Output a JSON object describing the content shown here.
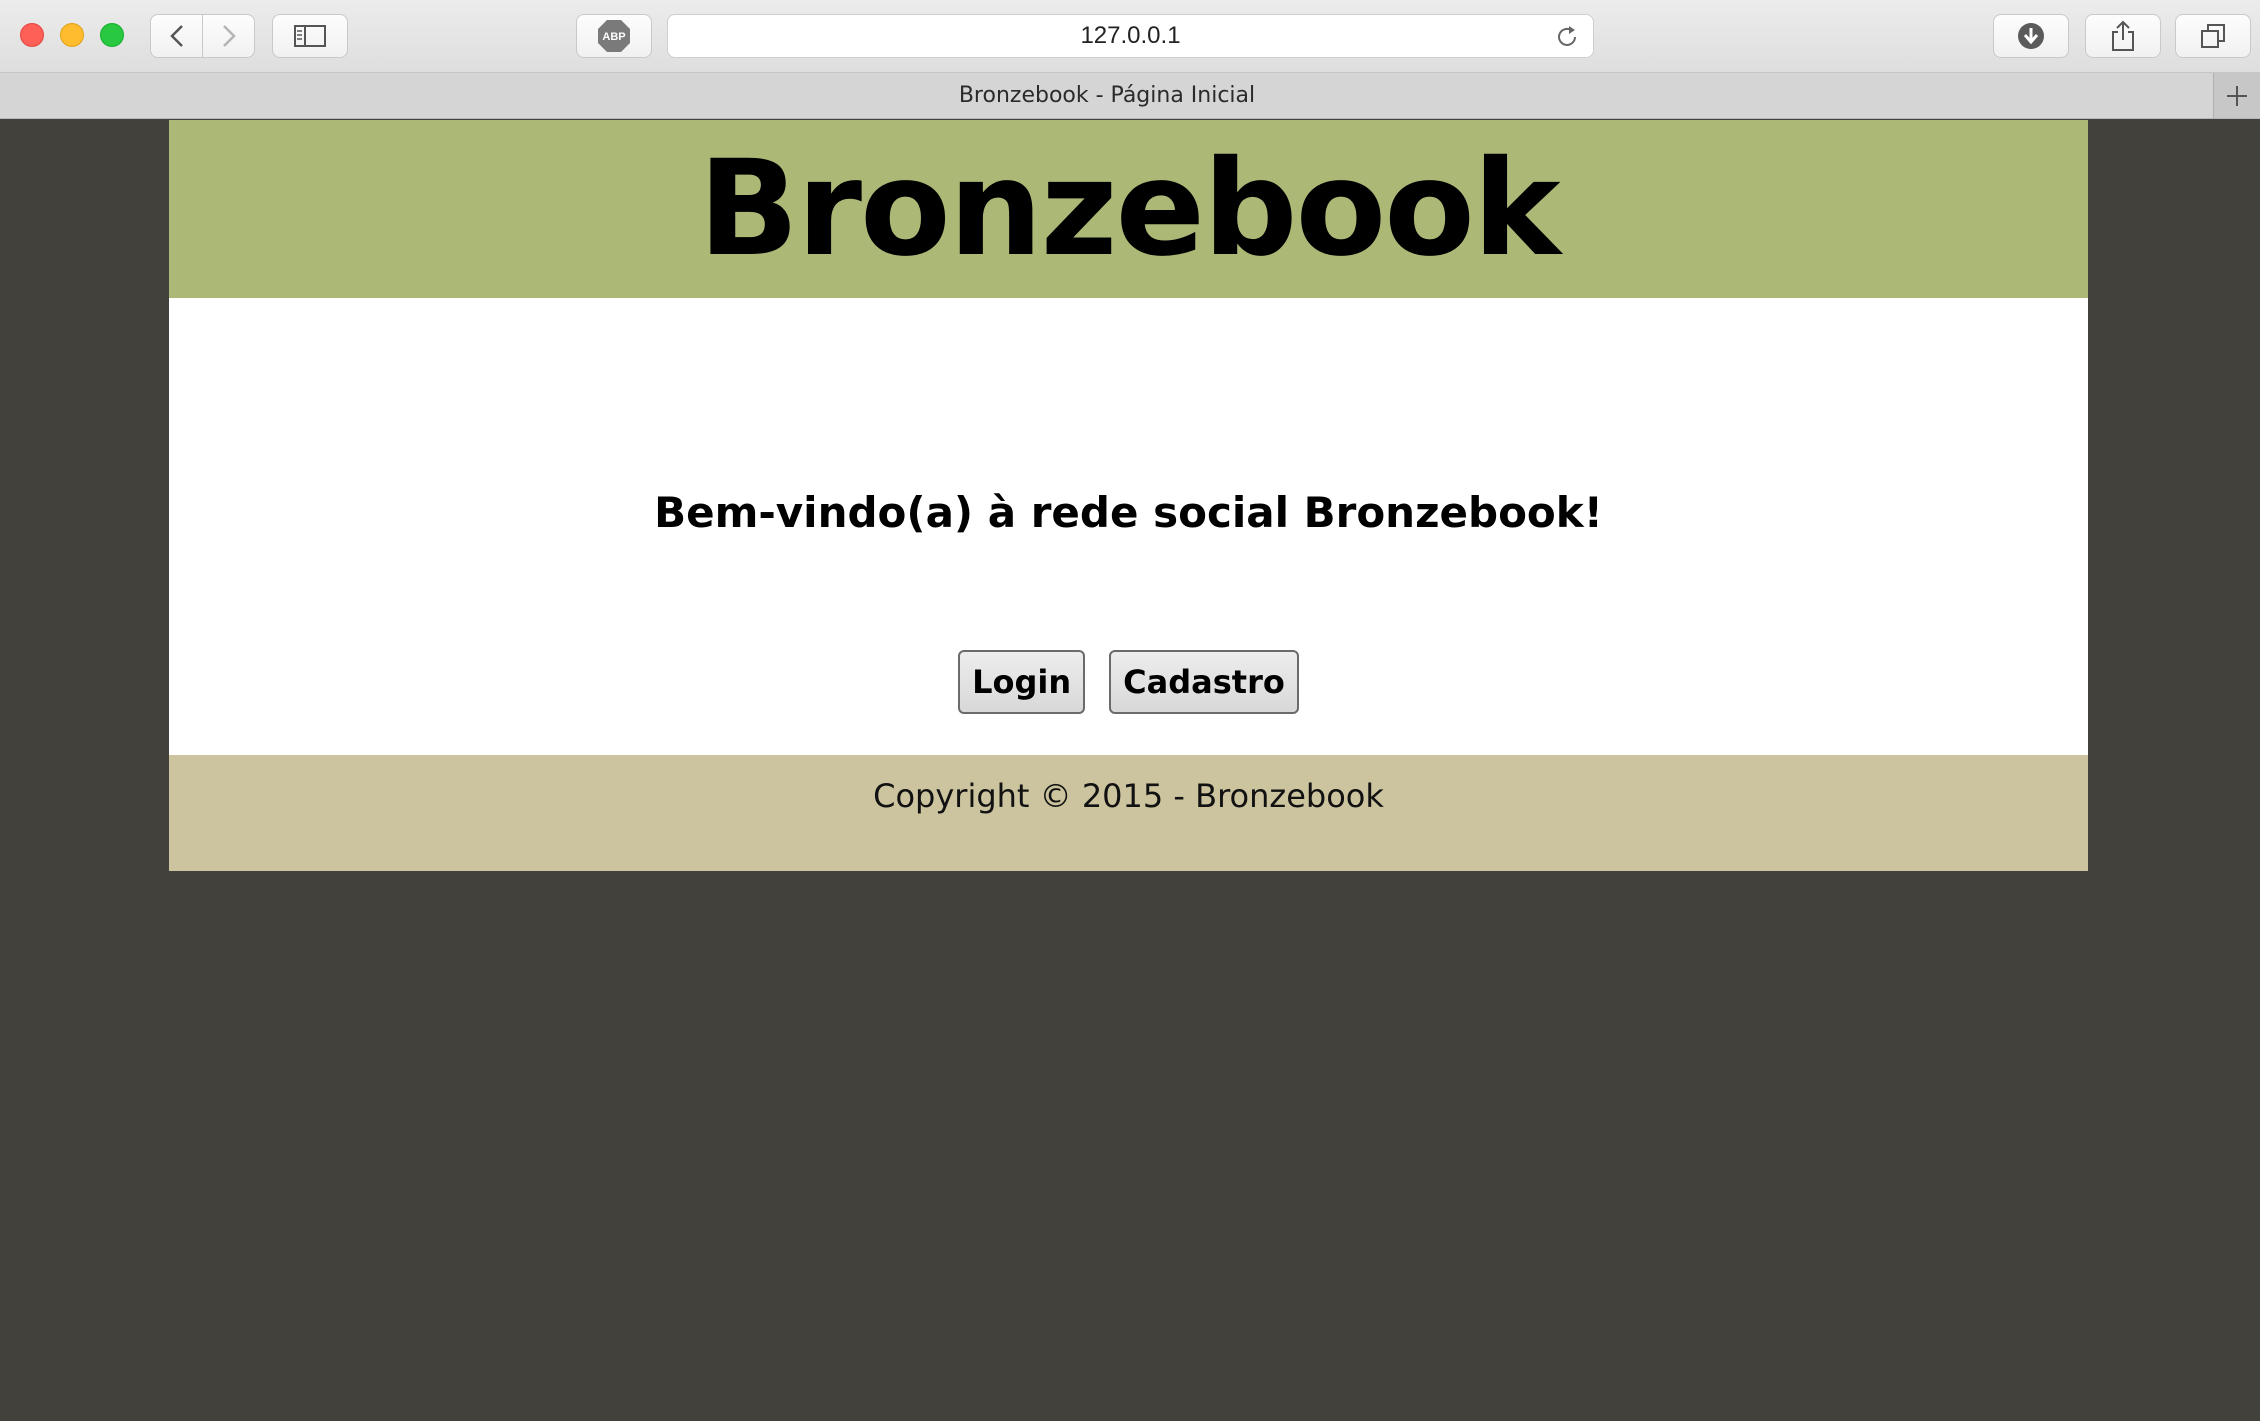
{
  "browser": {
    "address": "127.0.0.1",
    "tab_title": "Bronzebook - Página Inicial",
    "adblock_label": "ABP",
    "icons": [
      "close-button",
      "minimize-button",
      "zoom-button",
      "back-icon",
      "forward-icon",
      "sidebar-icon",
      "adblock-icon",
      "reload-icon",
      "download-icon",
      "share-icon",
      "tabs-overview-icon",
      "new-tab-icon"
    ]
  },
  "site": {
    "title": "Bronzebook",
    "welcome": "Bem-vindo(a) à rede social Bronzebook!",
    "buttons": {
      "login": "Login",
      "signup": "Cadastro"
    },
    "footer": "Copyright © 2015 - Bronzebook"
  },
  "colors": {
    "header_bg": "#acb876",
    "footer_bg": "#cbc49f",
    "page_bg": "#42413c",
    "content_bg": "#ffffff"
  }
}
